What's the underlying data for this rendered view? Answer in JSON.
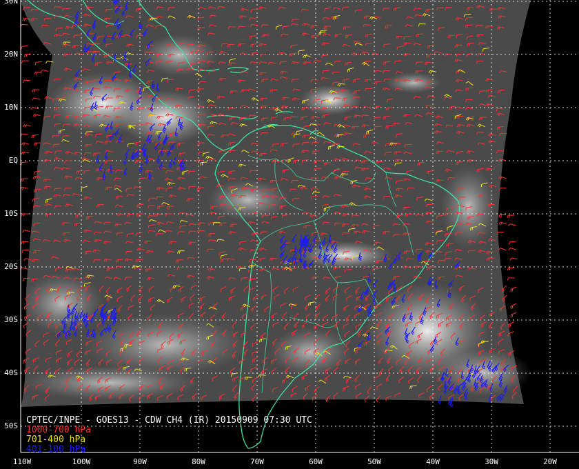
{
  "map": {
    "title": "CPTEC/INPE - GOES13 - CDW CH4 (IR) 20150909 07:30 UTC",
    "legend": [
      {
        "label": "1000-700 hPa",
        "color": "#ff3030"
      },
      {
        "label": "701-400 hPa",
        "color": "#f0e020"
      },
      {
        "label": "401-100 hPa",
        "color": "#1a1aff"
      }
    ],
    "lat_labels": [
      "30N",
      "20N",
      "10N",
      "EQ",
      "10S",
      "20S",
      "30S",
      "40S",
      "50S"
    ],
    "lon_labels": [
      "110W",
      "100W",
      "90W",
      "80W",
      "70W",
      "60W",
      "50W",
      "40W",
      "30W",
      "20W"
    ],
    "colors": {
      "background": "#000000",
      "borders": "#40e0a0",
      "gridlines": "#ffffff",
      "low_level": "#ff3030",
      "mid_level": "#f0e020",
      "high_level": "#1a1aff"
    }
  }
}
